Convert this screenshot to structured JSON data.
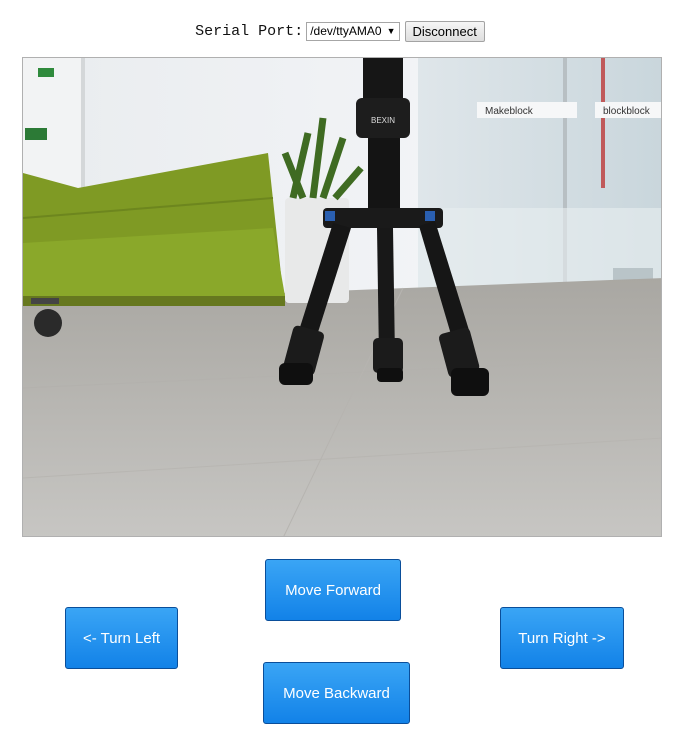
{
  "serial": {
    "label": "Serial Port:",
    "selected_port": "/dev/ttyAMA0",
    "disconnect_label": "Disconnect"
  },
  "camera": {
    "signs": {
      "wall_sign_1": "Makeblock",
      "wall_sign_2": "blockblock",
      "tripod_brand": "BEXIN"
    }
  },
  "controls": {
    "forward_label": "Move Forward",
    "left_label": "<- Turn Left",
    "right_label": "Turn Right ->",
    "backward_label": "Move Backward"
  },
  "colors": {
    "button_top": "#3aa5f5",
    "button_bottom": "#1282e8",
    "sofa": "#8aa82a"
  }
}
